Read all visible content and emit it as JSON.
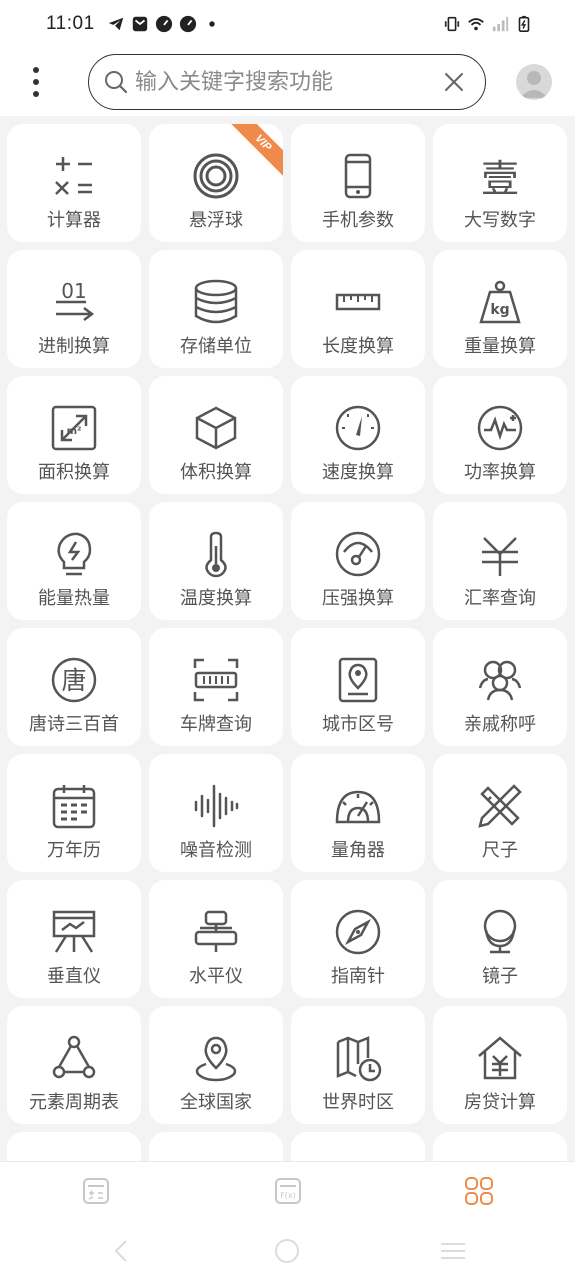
{
  "status_bar": {
    "time": "11:01",
    "left_icons": [
      "telegram-icon",
      "mail-icon",
      "speed-icon",
      "speed-icon",
      "dot-icon"
    ],
    "right_icons": [
      "vibrate-icon",
      "wifi-icon",
      "signal-icon",
      "battery-icon"
    ]
  },
  "header": {
    "search_placeholder": "输入关键字搜索功能"
  },
  "colors": {
    "accent": "#f0894a",
    "icon_gray": "#555555",
    "background": "#f3f3f3",
    "tile": "#ffffff"
  },
  "tools": [
    {
      "label": "计算器",
      "icon": "calculator-icon"
    },
    {
      "label": "悬浮球",
      "icon": "floating-ball-icon",
      "badge": "VIP"
    },
    {
      "label": "手机参数",
      "icon": "phone-icon"
    },
    {
      "label": "大写数字",
      "icon": "uppercase-number-icon"
    },
    {
      "label": "进制换算",
      "icon": "base-convert-icon"
    },
    {
      "label": "存储单位",
      "icon": "storage-icon"
    },
    {
      "label": "长度换算",
      "icon": "ruler-icon"
    },
    {
      "label": "重量换算",
      "icon": "weight-icon"
    },
    {
      "label": "面积换算",
      "icon": "area-icon"
    },
    {
      "label": "体积换算",
      "icon": "volume-cube-icon"
    },
    {
      "label": "速度换算",
      "icon": "speedometer-icon"
    },
    {
      "label": "功率换算",
      "icon": "power-icon"
    },
    {
      "label": "能量热量",
      "icon": "bulb-icon"
    },
    {
      "label": "温度换算",
      "icon": "thermometer-icon"
    },
    {
      "label": "压强换算",
      "icon": "pressure-gauge-icon"
    },
    {
      "label": "汇率查询",
      "icon": "yen-icon"
    },
    {
      "label": "唐诗三百首",
      "icon": "tang-poem-icon"
    },
    {
      "label": "车牌查询",
      "icon": "license-plate-icon"
    },
    {
      "label": "城市区号",
      "icon": "city-code-icon"
    },
    {
      "label": "亲戚称呼",
      "icon": "relatives-icon"
    },
    {
      "label": "万年历",
      "icon": "calendar-icon"
    },
    {
      "label": "噪音检测",
      "icon": "soundwave-icon"
    },
    {
      "label": "量角器",
      "icon": "protractor-icon"
    },
    {
      "label": "尺子",
      "icon": "ruler-pencil-icon"
    },
    {
      "label": "垂直仪",
      "icon": "vertical-icon"
    },
    {
      "label": "水平仪",
      "icon": "level-icon"
    },
    {
      "label": "指南针",
      "icon": "compass-icon"
    },
    {
      "label": "镜子",
      "icon": "mirror-icon"
    },
    {
      "label": "元素周期表",
      "icon": "element-table-icon"
    },
    {
      "label": "全球国家",
      "icon": "globe-pin-icon"
    },
    {
      "label": "世界时区",
      "icon": "world-clock-icon"
    },
    {
      "label": "房贷计算",
      "icon": "house-loan-icon"
    }
  ],
  "bottom_nav": [
    {
      "icon": "calculator-tab-icon",
      "active": false
    },
    {
      "icon": "function-tab-icon",
      "active": false
    },
    {
      "icon": "apps-grid-tab-icon",
      "active": true
    }
  ]
}
